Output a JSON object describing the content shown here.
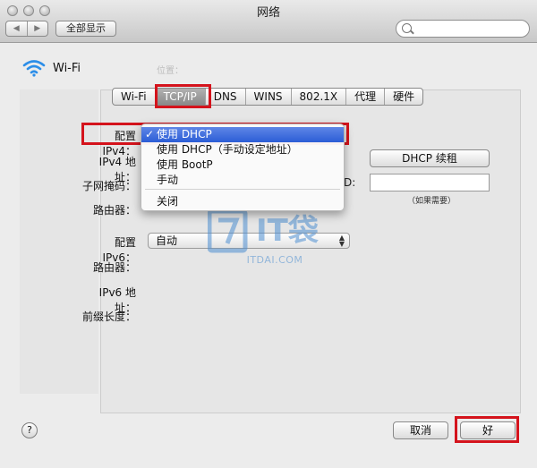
{
  "window": {
    "title": "网络"
  },
  "toolbar": {
    "show_all": "全部显示",
    "back_icon": "chevron-left-icon",
    "forward_icon": "chevron-right-icon",
    "search_icon": "search-icon"
  },
  "service": {
    "name": "Wi-Fi",
    "icon": "wifi-icon"
  },
  "tabs": [
    {
      "label": "Wi-Fi",
      "active": false
    },
    {
      "label": "TCP/IP",
      "active": true
    },
    {
      "label": "DNS",
      "active": false
    },
    {
      "label": "WINS",
      "active": false
    },
    {
      "label": "802.1X",
      "active": false
    },
    {
      "label": "代理",
      "active": false
    },
    {
      "label": "硬件",
      "active": false
    }
  ],
  "form": {
    "configure_ipv4_label": "配置 IPv4：",
    "ipv4_address_label": "IPv4 地址：",
    "subnet_mask_label": "子网掩码：",
    "router_label": "路由器：",
    "configure_ipv6_label": "配置 IPv6：",
    "configure_ipv6_value": "自动",
    "router6_label": "路由器：",
    "ipv6_address_label": "IPv6 地址：",
    "prefix_length_label": "前缀长度：",
    "renew_dhcp": "DHCP 续租",
    "client_id_suffix": "D:",
    "if_required": "（如果需要）"
  },
  "ipv4_menu": {
    "items": [
      {
        "label": "使用 DHCP",
        "selected": true
      },
      {
        "label": "使用 DHCP（手动设定地址）",
        "selected": false
      },
      {
        "label": "使用 BootP",
        "selected": false
      },
      {
        "label": "手动",
        "selected": false
      },
      {
        "label": "关闭",
        "selected": false
      }
    ],
    "check_mark": "✓"
  },
  "watermark": {
    "brand": "IT袋",
    "domain": "ITDAI.COM"
  },
  "footer": {
    "help": "?",
    "cancel": "取消",
    "ok": "好"
  },
  "colors": {
    "highlight": "#d4131c",
    "menu_selection": "#2b5dd6",
    "watermark": "#4f8fd1"
  }
}
